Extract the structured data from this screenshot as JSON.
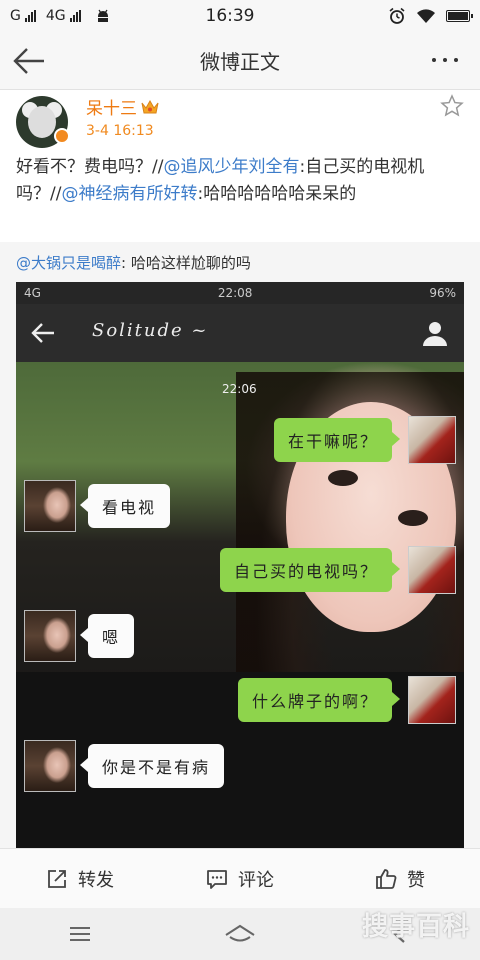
{
  "status_bar": {
    "carrier_left": "G",
    "network": "4G",
    "time": "16:39"
  },
  "nav": {
    "title": "微博正文"
  },
  "post": {
    "username": "呆十三",
    "time": "3-4 16:13",
    "content": [
      {
        "type": "text",
        "text": "好看不？费电吗？//"
      },
      {
        "type": "mention",
        "text": "@追风少年刘全有"
      },
      {
        "type": "text",
        "text": ":自己买的电视机吗？//"
      },
      {
        "type": "mention",
        "text": "@神经病有所好转"
      },
      {
        "type": "text",
        "text": ":哈哈哈哈哈哈呆呆的"
      }
    ]
  },
  "repost": {
    "mention": "@大锅只是喝醉",
    "text": ": 哈哈这样尬聊的吗"
  },
  "screenshot": {
    "status_left": "4G",
    "status_time": "22:08",
    "status_battery": "96%",
    "chat_name": "Solitude ~",
    "chat_time": "22:06",
    "messages": [
      {
        "side": "right",
        "text": "在干嘛呢？"
      },
      {
        "side": "left",
        "text": "看电视"
      },
      {
        "side": "right",
        "text": "自己买的电视吗？"
      },
      {
        "side": "left",
        "text": "嗯"
      },
      {
        "side": "right",
        "text": "什么牌子的啊？"
      },
      {
        "side": "left",
        "text": "你是不是有病"
      }
    ]
  },
  "actions": {
    "repost": "转发",
    "comment": "评论",
    "like": "赞"
  },
  "watermark": "搜事百科"
}
